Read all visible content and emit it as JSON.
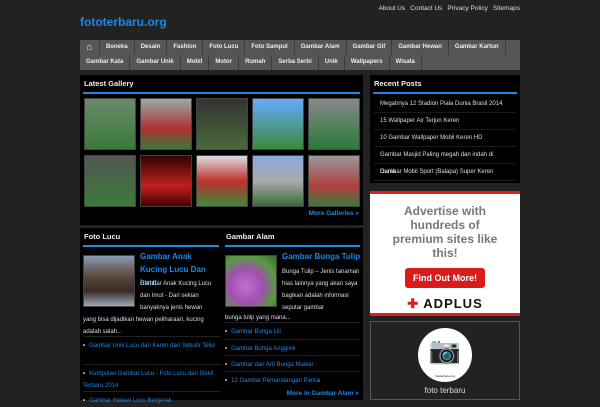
{
  "header": {
    "title": "fototerbaru.org",
    "links": [
      "About Us",
      "Contact Us",
      "Privacy Policy",
      "Sitemaps"
    ]
  },
  "nav": {
    "home_icon": "home-icon",
    "items": [
      "Boneka",
      "Desain",
      "Fashion",
      "Foto Lucu",
      "Foto Sampul",
      "Gambar Alam",
      "Gambar Gif",
      "Gambar Hewan",
      "Gambar Kartun",
      "Gambar Kata",
      "Gambar Unik",
      "Mobil",
      "Motor",
      "Rumah",
      "Serba Serbi",
      "Unik",
      "Wallpapers",
      "Wisata"
    ]
  },
  "gallery": {
    "title": "Latest Gallery",
    "more": "More Galleries »"
  },
  "foto_lucu": {
    "title": "Foto Lucu",
    "post_title": "Gambar Anak Kucing Lucu Dan Imut",
    "excerpt_a": "Gambar Anak Kucing Lucu dan Imut - Dari sekian banyaknya jenis hewan",
    "excerpt_b": "yang bisa dijadikan hewan peliharaan, kucing adalah salah...",
    "links": [
      "Gambar Unik Lucu dan Keren dari Sebutir Telur",
      "Kumpulan Gambar Lucu - Foto Lucu dan Gokil Terbaru 2014",
      "Gambar Hewan Lucu Bergerak"
    ]
  },
  "gambar_alam": {
    "title": "Gambar Alam",
    "post_title": "Gambar Bunga Tulip",
    "excerpt_a": "Bunga Tulip – Jenis tanaman hias lainnya yang akan saya bagikan adalah informasi seputar gambar",
    "excerpt_b": "bunga tulip yang mana...",
    "links": [
      "Gambar Bunga Lili",
      "Gambar Bunga Anggrek",
      "Gambar dan Arti Bunga Mawar",
      "12 Gambar Pemandangan Pantai"
    ],
    "more": "More in Gambar Alam »"
  },
  "recent": {
    "title": "Recent Posts",
    "items": [
      "Megahnya 12 Stadion Piala Dunia Brasil 2014",
      "15 Wallpaper Air Terjun Keren",
      "10 Gambar Wallpaper Mobil Keren HD",
      "Gambar Masjid Paling megah dan indah di Dunia",
      "Gambar Mobil Sport (Balapa) Super Keren"
    ]
  },
  "ad": {
    "headline": "Advertise with hundreds of premium sites like this!",
    "button": "Find Out More!",
    "brand": "ADPLUS"
  },
  "profile": {
    "name": "foto terbaru",
    "logo_text": "fototerbaru.org"
  }
}
